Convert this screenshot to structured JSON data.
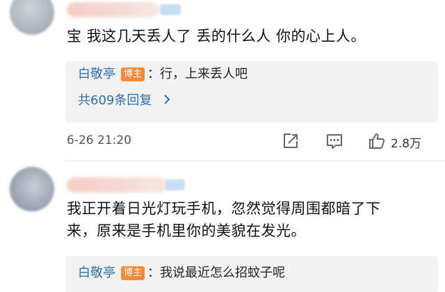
{
  "comments": [
    {
      "text": "宝 我这几天丢人了 丢的什么人 你的心上人。",
      "reply": {
        "user": "白敬亭",
        "badge": "博主",
        "text": "：行，上来丢人吧"
      },
      "reply_count": "共609条回复",
      "reply_count_chevron": ">",
      "time": "6-26 21:20",
      "likes": "2.8万"
    },
    {
      "text_line1": "我正开着日光灯玩手机，忽然觉得周围都暗了下",
      "text_line2": "来，原来是手机里你的美貌在发光。",
      "reply": {
        "user": "白敬亭",
        "badge": "博主",
        "text": "：我说最近怎么招蚊子呢"
      }
    }
  ],
  "icons": {
    "share": "share-icon",
    "comment": "comment-icon",
    "like": "thumbs-up-icon"
  },
  "colors": {
    "reply_user": "#2f6fb0",
    "badge_bg": "#f28a3a",
    "reply_bg": "#f2f2f2"
  }
}
